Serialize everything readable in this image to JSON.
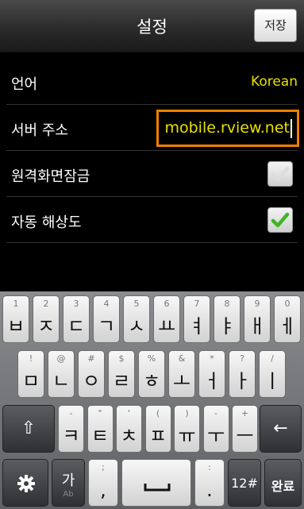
{
  "header": {
    "title": "설정",
    "save_label": "저장"
  },
  "settings": {
    "language": {
      "label": "언어",
      "value": "Korean"
    },
    "server": {
      "label": "서버 주소",
      "value": "mobile.rview.net"
    },
    "remote_lock": {
      "label": "원격화면잠금",
      "checked": false
    },
    "auto_resolution": {
      "label": "자동 해상도",
      "checked": true
    }
  },
  "keyboard": {
    "row1": [
      {
        "hint": "1",
        "main": "ㅂ"
      },
      {
        "hint": "2",
        "main": "ㅈ"
      },
      {
        "hint": "3",
        "main": "ㄷ"
      },
      {
        "hint": "4",
        "main": "ㄱ"
      },
      {
        "hint": "5",
        "main": "ㅅ"
      },
      {
        "hint": "6",
        "main": "ㅛ"
      },
      {
        "hint": "7",
        "main": "ㅕ"
      },
      {
        "hint": "8",
        "main": "ㅑ"
      },
      {
        "hint": "9",
        "main": "ㅐ"
      },
      {
        "hint": "0",
        "main": "ㅔ"
      }
    ],
    "row2": [
      {
        "hint": "!",
        "main": "ㅁ"
      },
      {
        "hint": "@",
        "main": "ㄴ"
      },
      {
        "hint": "#",
        "main": "ㅇ"
      },
      {
        "hint": "$",
        "main": "ㄹ"
      },
      {
        "hint": "%",
        "main": "ㅎ"
      },
      {
        "hint": "&",
        "main": "ㅗ"
      },
      {
        "hint": "*",
        "main": "ㅓ"
      },
      {
        "hint": "?",
        "main": "ㅏ"
      },
      {
        "hint": "/",
        "main": "ㅣ"
      }
    ],
    "row3": [
      {
        "hint": "-",
        "main": "ㅋ"
      },
      {
        "hint": "\"",
        "main": "ㅌ"
      },
      {
        "hint": "'",
        "main": "ㅊ"
      },
      {
        "hint": "(",
        "main": "ㅍ"
      },
      {
        "hint": ")",
        "main": "ㅠ"
      },
      {
        "hint": "-",
        "main": "ㅜ"
      },
      {
        "hint": "+",
        "main": "ㅡ"
      }
    ],
    "shift_label": "⇧",
    "backspace_label": "←",
    "settings_icon": "gear-icon",
    "lang_main": "가",
    "lang_sub": "Ab",
    "semicolon_hint": ";",
    "comma_main": ",",
    "colon_hint": ":",
    "period_main": ".",
    "numeric_label": "12#",
    "done_label": "완료"
  }
}
